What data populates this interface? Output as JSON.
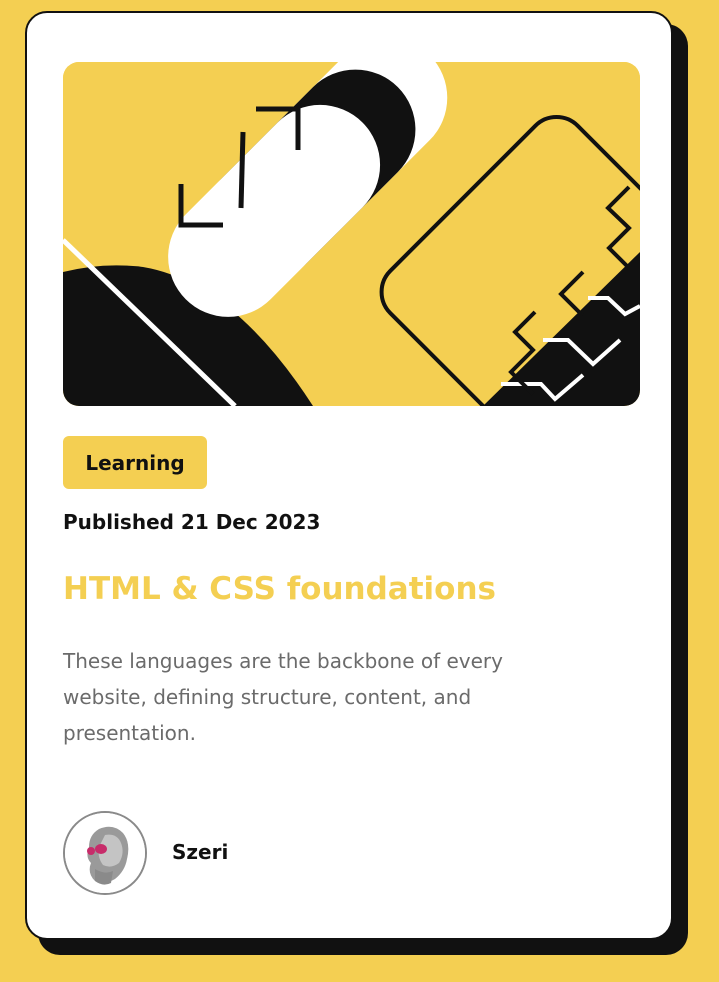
{
  "card": {
    "category_tag": "Learning",
    "published": "Published 21 Dec 2023",
    "title": "HTML & CSS foundations",
    "description": "These languages are the backbone of every website, defining structure, content, and presentation.",
    "author_name": "Szeri"
  },
  "theme": {
    "accent": "#F4CF52",
    "dark": "#111111",
    "body_text": "#6B6B6B"
  },
  "icons": {
    "hero_illustration": "code-bracket-illustration",
    "avatar": "user-avatar-image"
  }
}
